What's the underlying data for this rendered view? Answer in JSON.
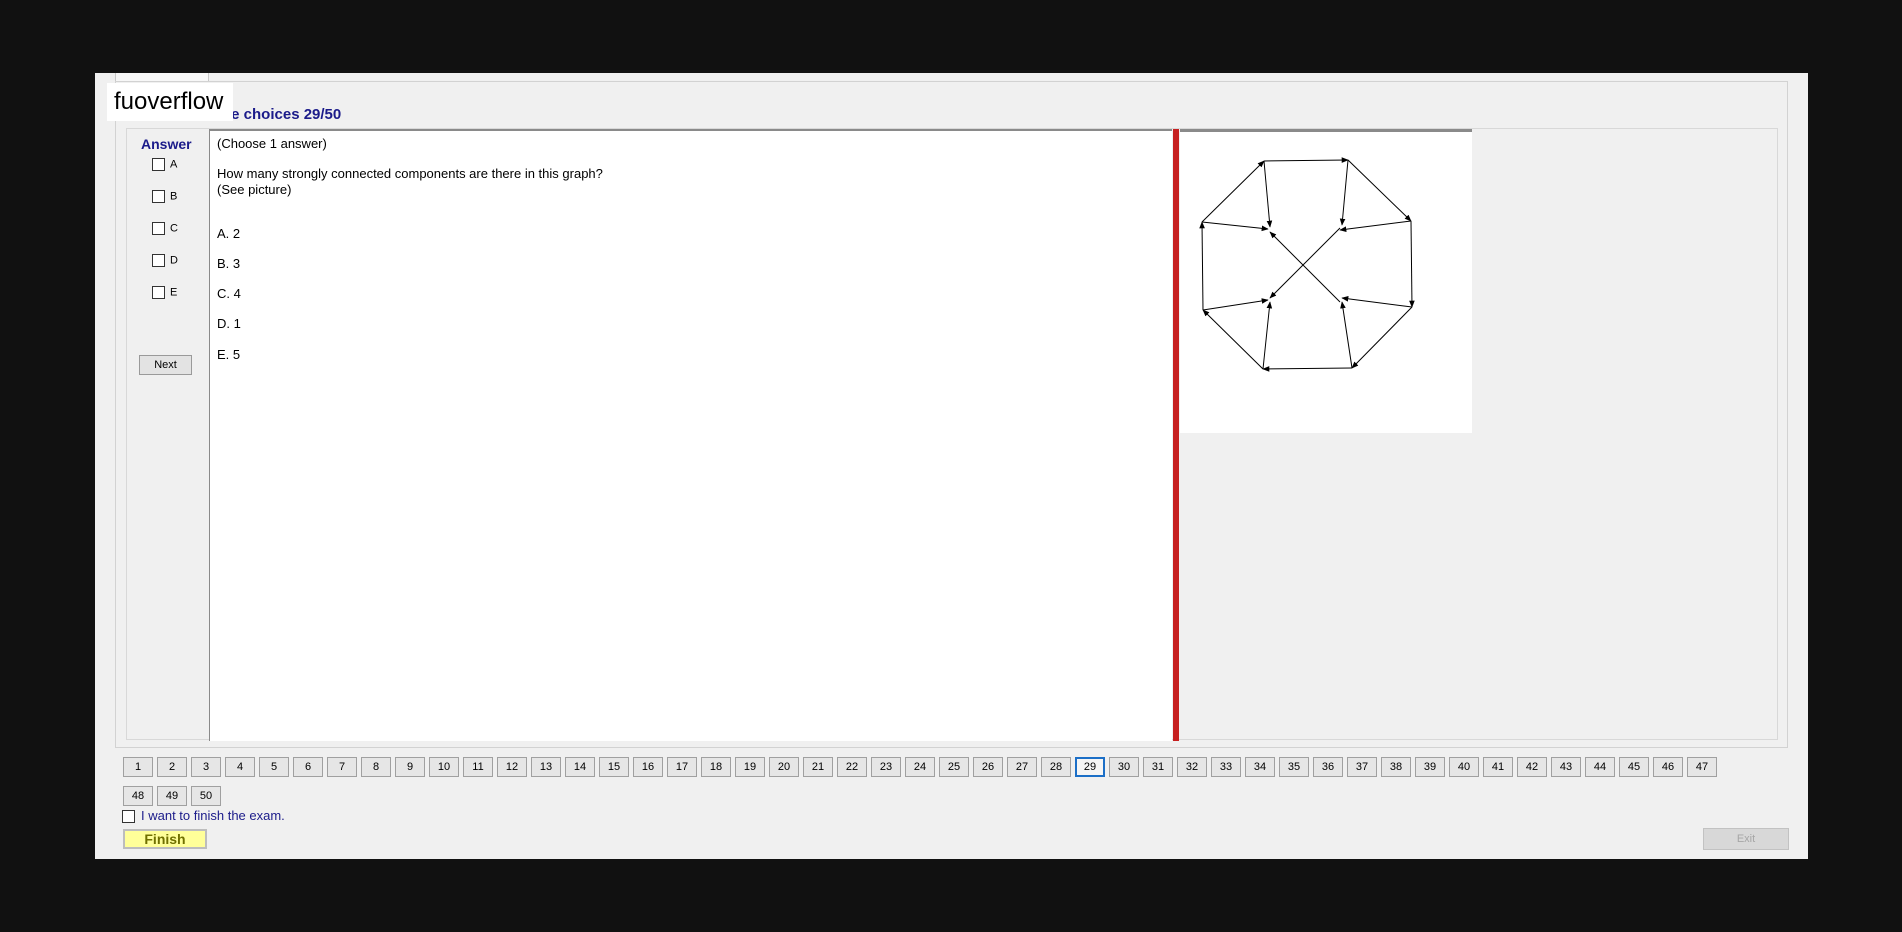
{
  "header": {
    "title": "le choices 29/50",
    "watermark": "fuoverflow"
  },
  "answer_panel": {
    "title": "Answer",
    "options": [
      "A",
      "B",
      "C",
      "D",
      "E"
    ],
    "next_label": "Next"
  },
  "question": {
    "instruction": "(Choose 1 answer)",
    "text": "How many strongly connected components are there in this graph?",
    "note": "(See picture)",
    "choices": [
      "A.  2",
      "B.  3",
      "C.  4",
      "D.  1",
      "E.  5"
    ]
  },
  "navigation": {
    "numbers": [
      "1",
      "2",
      "3",
      "4",
      "5",
      "6",
      "7",
      "8",
      "9",
      "10",
      "11",
      "12",
      "13",
      "14",
      "15",
      "16",
      "17",
      "18",
      "19",
      "20",
      "21",
      "22",
      "23",
      "24",
      "25",
      "26",
      "27",
      "28",
      "29",
      "30",
      "31",
      "32",
      "33",
      "34",
      "35",
      "36",
      "37",
      "38",
      "39",
      "40",
      "41",
      "42",
      "43",
      "44",
      "45",
      "46",
      "47",
      "48",
      "49",
      "50"
    ],
    "current": "29"
  },
  "footer": {
    "finish_checkbox_label": "I want to finish the exam.",
    "finish_label": "Finish",
    "exit_label": "Exit"
  },
  "colors": {
    "frame": "#111111",
    "accent_title": "#1b1b8a",
    "splitter": "#c62020",
    "finish_bg": "#ffff99",
    "current_border": "#1c6fc7"
  }
}
